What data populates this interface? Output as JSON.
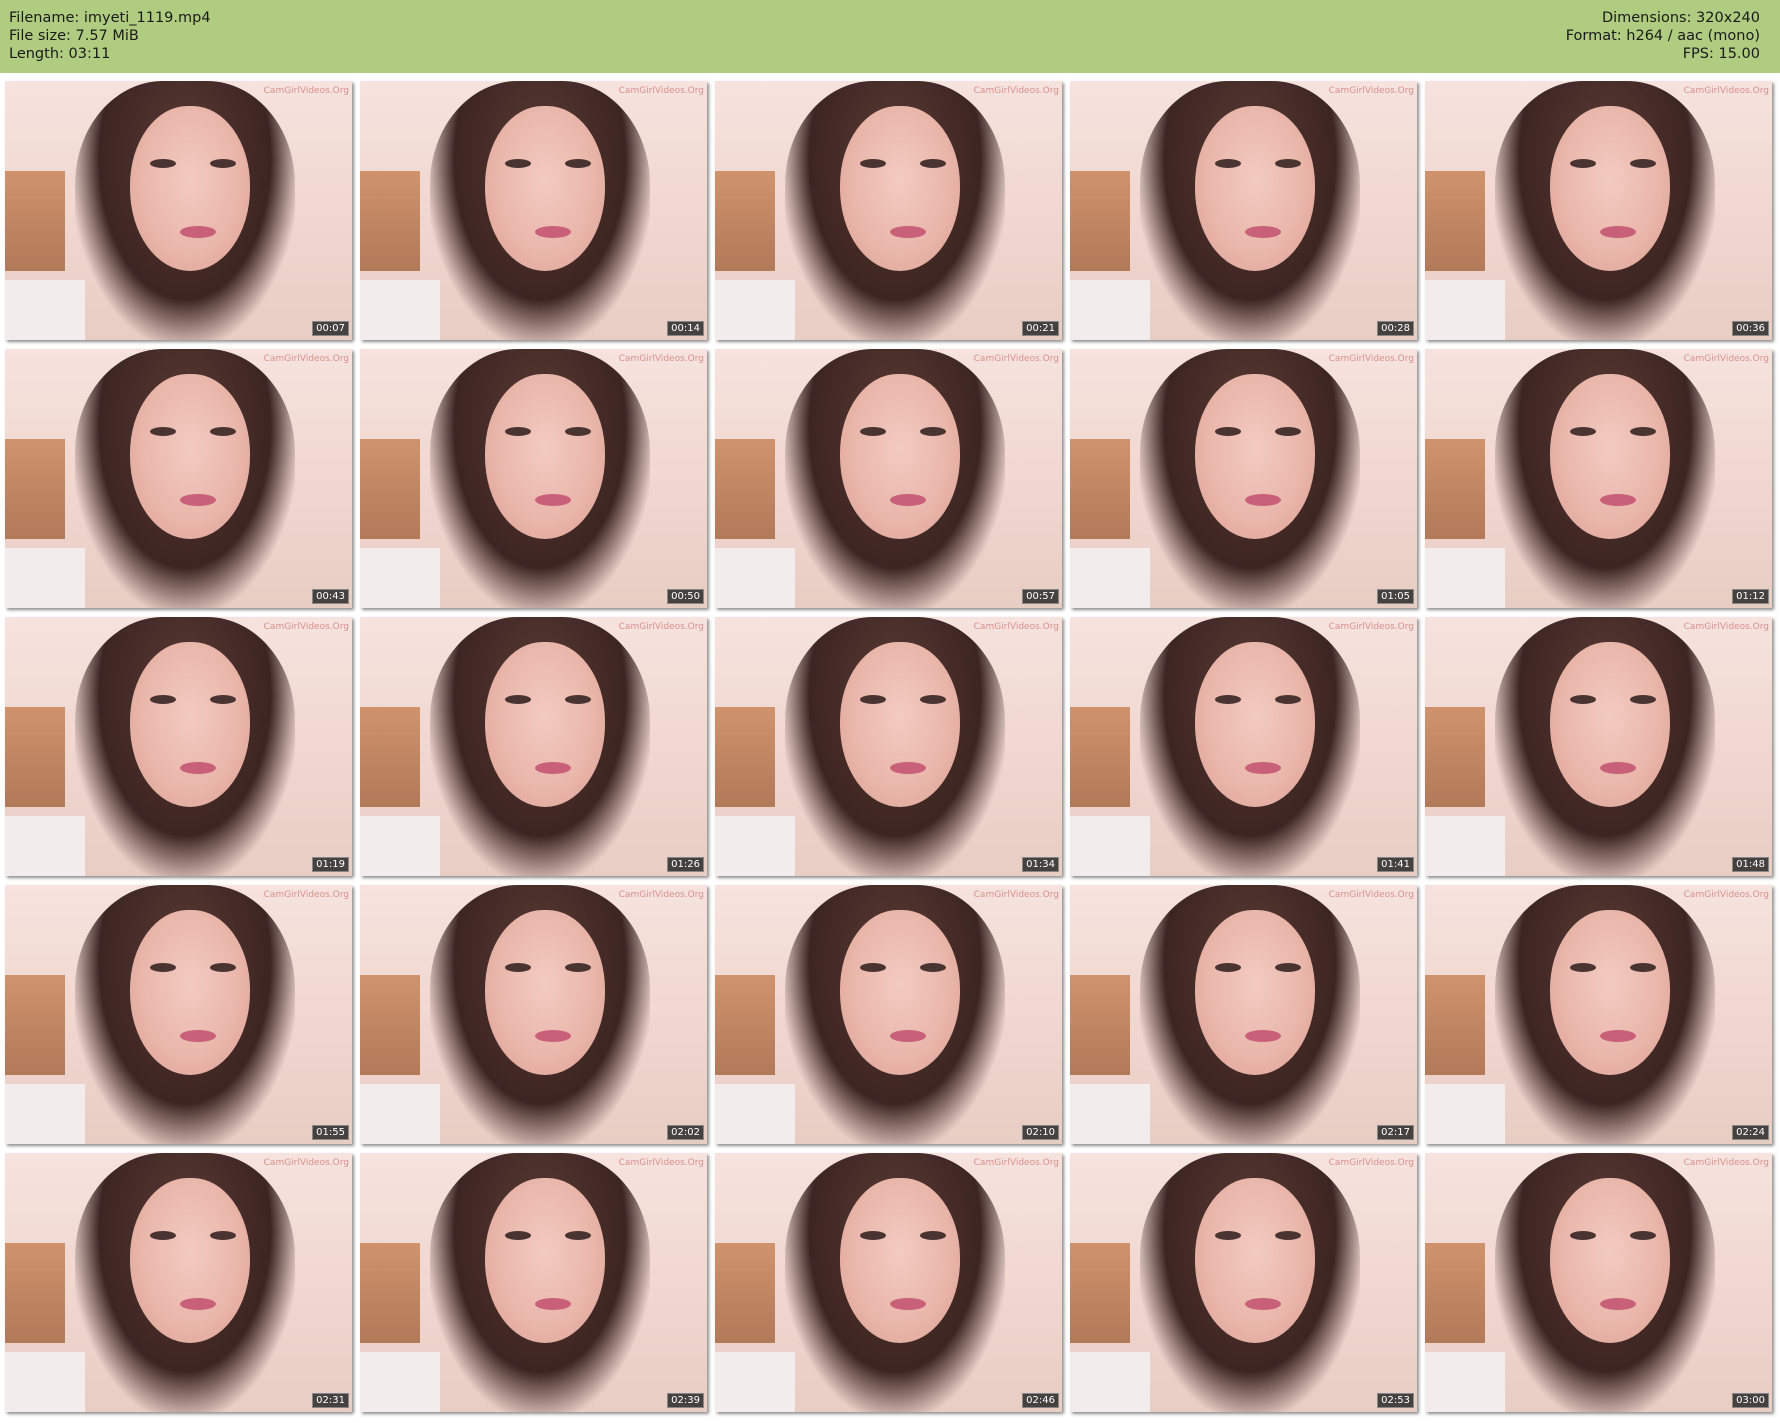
{
  "header": {
    "filename": "Filename: imyeti_1119.mp4",
    "filesize": "File size: 7.57 MiB",
    "length": "Length: 03:11",
    "dimensions": "Dimensions: 320x240",
    "format": "Format: h264 / aac (mono)",
    "fps": "FPS: 15.00"
  },
  "colors": {
    "header_bg": "#b0cc80"
  },
  "watermark": "CamGirlVideos.Org",
  "timestamps": [
    "00:07",
    "00:14",
    "00:21",
    "00:28",
    "00:36",
    "00:43",
    "00:50",
    "00:57",
    "01:05",
    "01:12",
    "01:19",
    "01:26",
    "01:34",
    "01:41",
    "01:48",
    "01:55",
    "02:02",
    "02:10",
    "02:17",
    "02:24",
    "02:31",
    "02:39",
    "02:46",
    "02:53",
    "03:00"
  ]
}
